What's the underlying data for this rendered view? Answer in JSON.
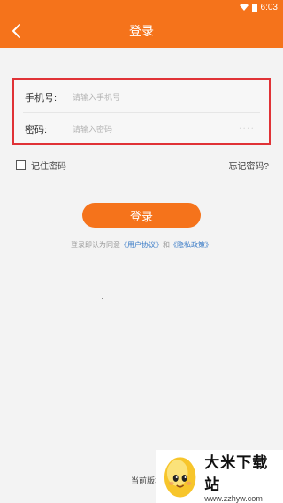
{
  "status_bar": {
    "time": "6:03"
  },
  "header": {
    "title": "登录"
  },
  "form": {
    "phone_label": "手机号:",
    "phone_placeholder": "请输入手机号",
    "password_label": "密码:",
    "password_placeholder": "请输入密码"
  },
  "options": {
    "remember_label": "记住密码",
    "remember_checked": false,
    "forgot_label": "忘记密码?"
  },
  "login_button": {
    "label": "登录"
  },
  "agreement": {
    "prefix": "登录即认为同意",
    "user_agreement": "《用户协议》",
    "conjunction": "和",
    "privacy_policy": "《隐私政策》"
  },
  "footer": {
    "version_label": "当前版本号:"
  },
  "watermark": {
    "title": "大米下载站",
    "url": "www.zzhyw.com"
  },
  "colors": {
    "brand": "#f5731b",
    "highlight_border": "#e03236",
    "link": "#3b7cc7"
  }
}
